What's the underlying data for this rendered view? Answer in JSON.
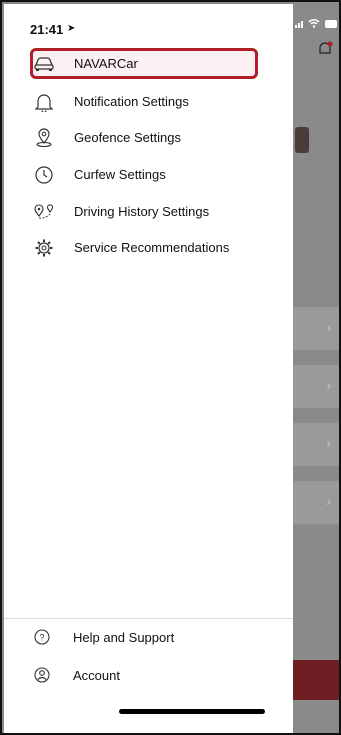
{
  "status": {
    "time": "21:41",
    "location_icon": "location-arrow-icon"
  },
  "menu": {
    "items": [
      {
        "label": "NAVARCar",
        "icon": "car-icon",
        "selected": true
      },
      {
        "label": "Notification Settings",
        "icon": "bell-icon"
      },
      {
        "label": "Geofence Settings",
        "icon": "location-pin-icon"
      },
      {
        "label": "Curfew Settings",
        "icon": "clock-icon"
      },
      {
        "label": "Driving History Settings",
        "icon": "route-icon"
      },
      {
        "label": "Service Recommendations",
        "icon": "gear-icon"
      }
    ]
  },
  "bottom": {
    "help": {
      "label": "Help and Support",
      "icon": "question-icon"
    },
    "account": {
      "label": "Account",
      "icon": "user-icon"
    }
  },
  "colors": {
    "accent": "#b01e28",
    "selected_bg": "#fcf1f2",
    "overlay": "#8a8a8a"
  }
}
